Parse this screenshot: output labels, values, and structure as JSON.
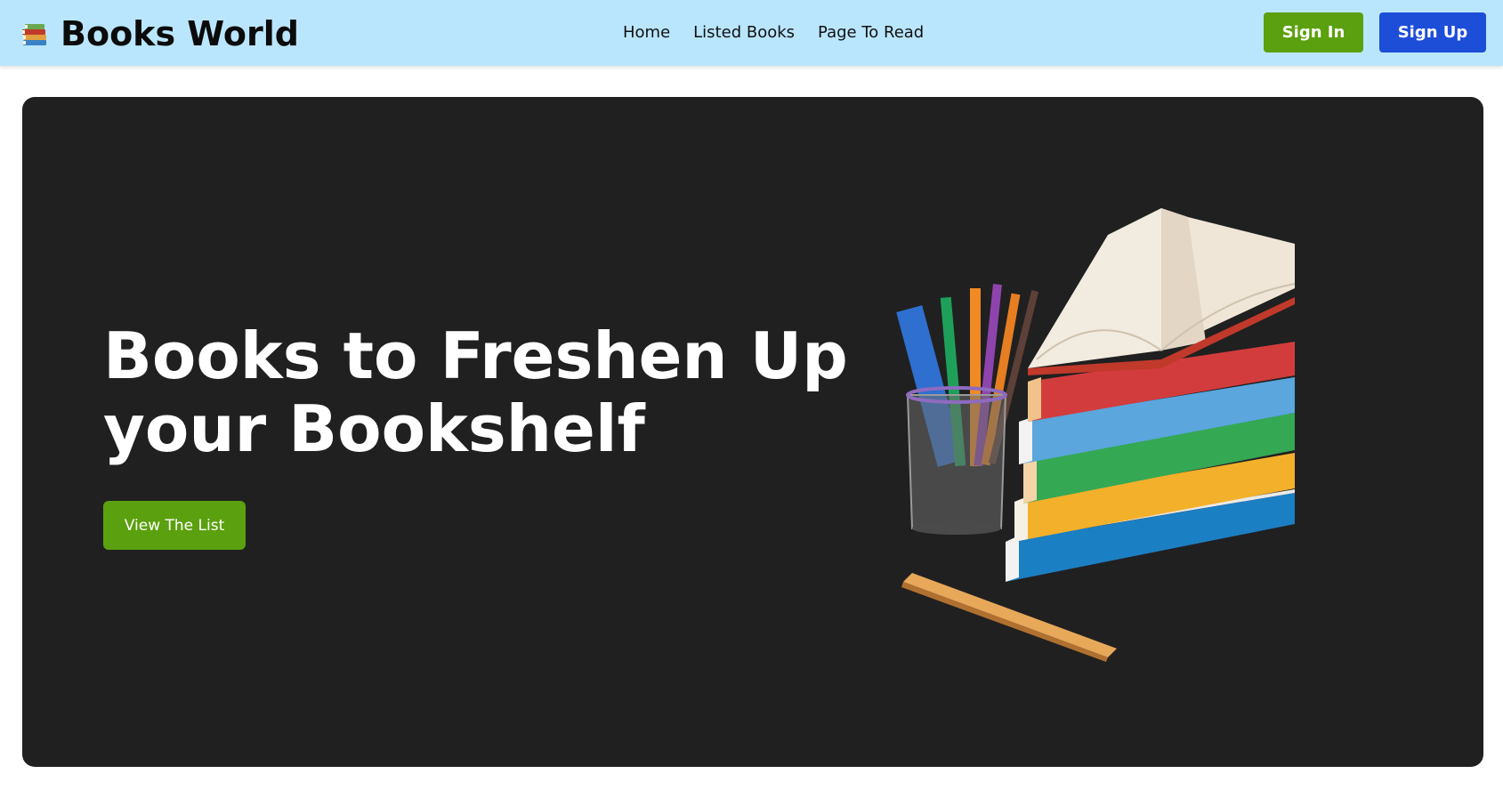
{
  "header": {
    "brand": "Books World",
    "brand_icon": "books-stack-icon",
    "nav": [
      {
        "label": "Home"
      },
      {
        "label": "Listed Books"
      },
      {
        "label": "Page To Read"
      }
    ],
    "sign_in_label": "Sign In",
    "sign_up_label": "Sign Up",
    "colors": {
      "header_bg": "#bae6fd",
      "sign_in": "#5ba00e",
      "sign_up": "#1d4ed8"
    }
  },
  "hero": {
    "title": "Books to Freshen Up your Bookshelf",
    "cta_label": "View The List",
    "image_subject": "stack of colorful books with open book, pencil cup and ruler",
    "colors": {
      "background": "#202020",
      "cta": "#5ba00e"
    }
  }
}
